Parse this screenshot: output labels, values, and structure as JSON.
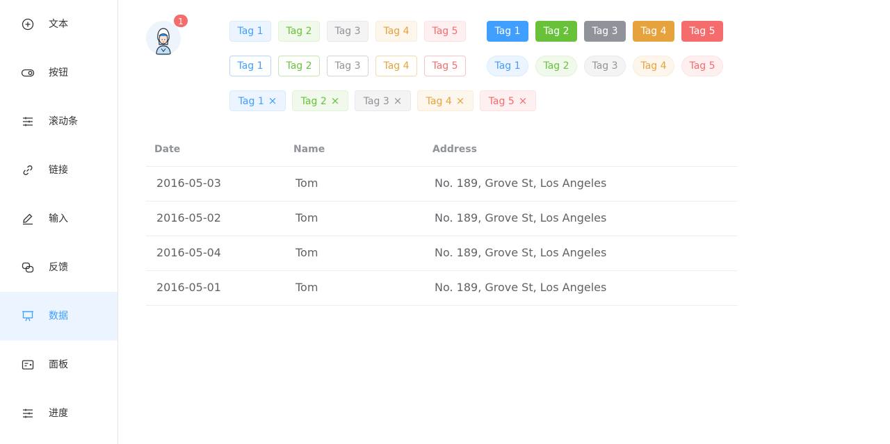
{
  "sidebar": {
    "items": [
      {
        "label": "文本",
        "icon": "plus-circle-icon"
      },
      {
        "label": "按钮",
        "icon": "toggle-icon"
      },
      {
        "label": "滚动条",
        "icon": "sliders-icon"
      },
      {
        "label": "链接",
        "icon": "link-icon"
      },
      {
        "label": "输入",
        "icon": "edit-pen-icon"
      },
      {
        "label": "反馈",
        "icon": "chat-bubbles-icon"
      },
      {
        "label": "数据",
        "icon": "presentation-board-icon",
        "active": true
      },
      {
        "label": "面板",
        "icon": "panel-card-icon"
      },
      {
        "label": "进度",
        "icon": "sliders-icon"
      }
    ]
  },
  "avatar": {
    "icon": "user-avatar-icon",
    "badge": "1"
  },
  "tags": {
    "light": [
      "Tag 1",
      "Tag 2",
      "Tag 3",
      "Tag 4",
      "Tag 5"
    ],
    "dark": [
      "Tag 1",
      "Tag 2",
      "Tag 3",
      "Tag 4",
      "Tag 5"
    ],
    "plain": [
      "Tag 1",
      "Tag 2",
      "Tag 3",
      "Tag 4",
      "Tag 5"
    ],
    "round": [
      "Tag 1",
      "Tag 2",
      "Tag 3",
      "Tag 4",
      "Tag 5"
    ],
    "closable": [
      "Tag 1",
      "Tag 2",
      "Tag 3",
      "Tag 4",
      "Tag 5"
    ],
    "close_glyph": "×"
  },
  "colors": {
    "primary": "#409eff",
    "success": "#67c23a",
    "info": "#909399",
    "warning": "#e6a23c",
    "danger": "#f56c6c"
  },
  "table": {
    "headers": {
      "date": "Date",
      "name": "Name",
      "address": "Address"
    },
    "rows": [
      {
        "date": "2016-05-03",
        "name": "Tom",
        "address": "No. 189, Grove St, Los Angeles"
      },
      {
        "date": "2016-05-02",
        "name": "Tom",
        "address": "No. 189, Grove St, Los Angeles"
      },
      {
        "date": "2016-05-04",
        "name": "Tom",
        "address": "No. 189, Grove St, Los Angeles"
      },
      {
        "date": "2016-05-01",
        "name": "Tom",
        "address": "No. 189, Grove St, Los Angeles"
      }
    ]
  }
}
